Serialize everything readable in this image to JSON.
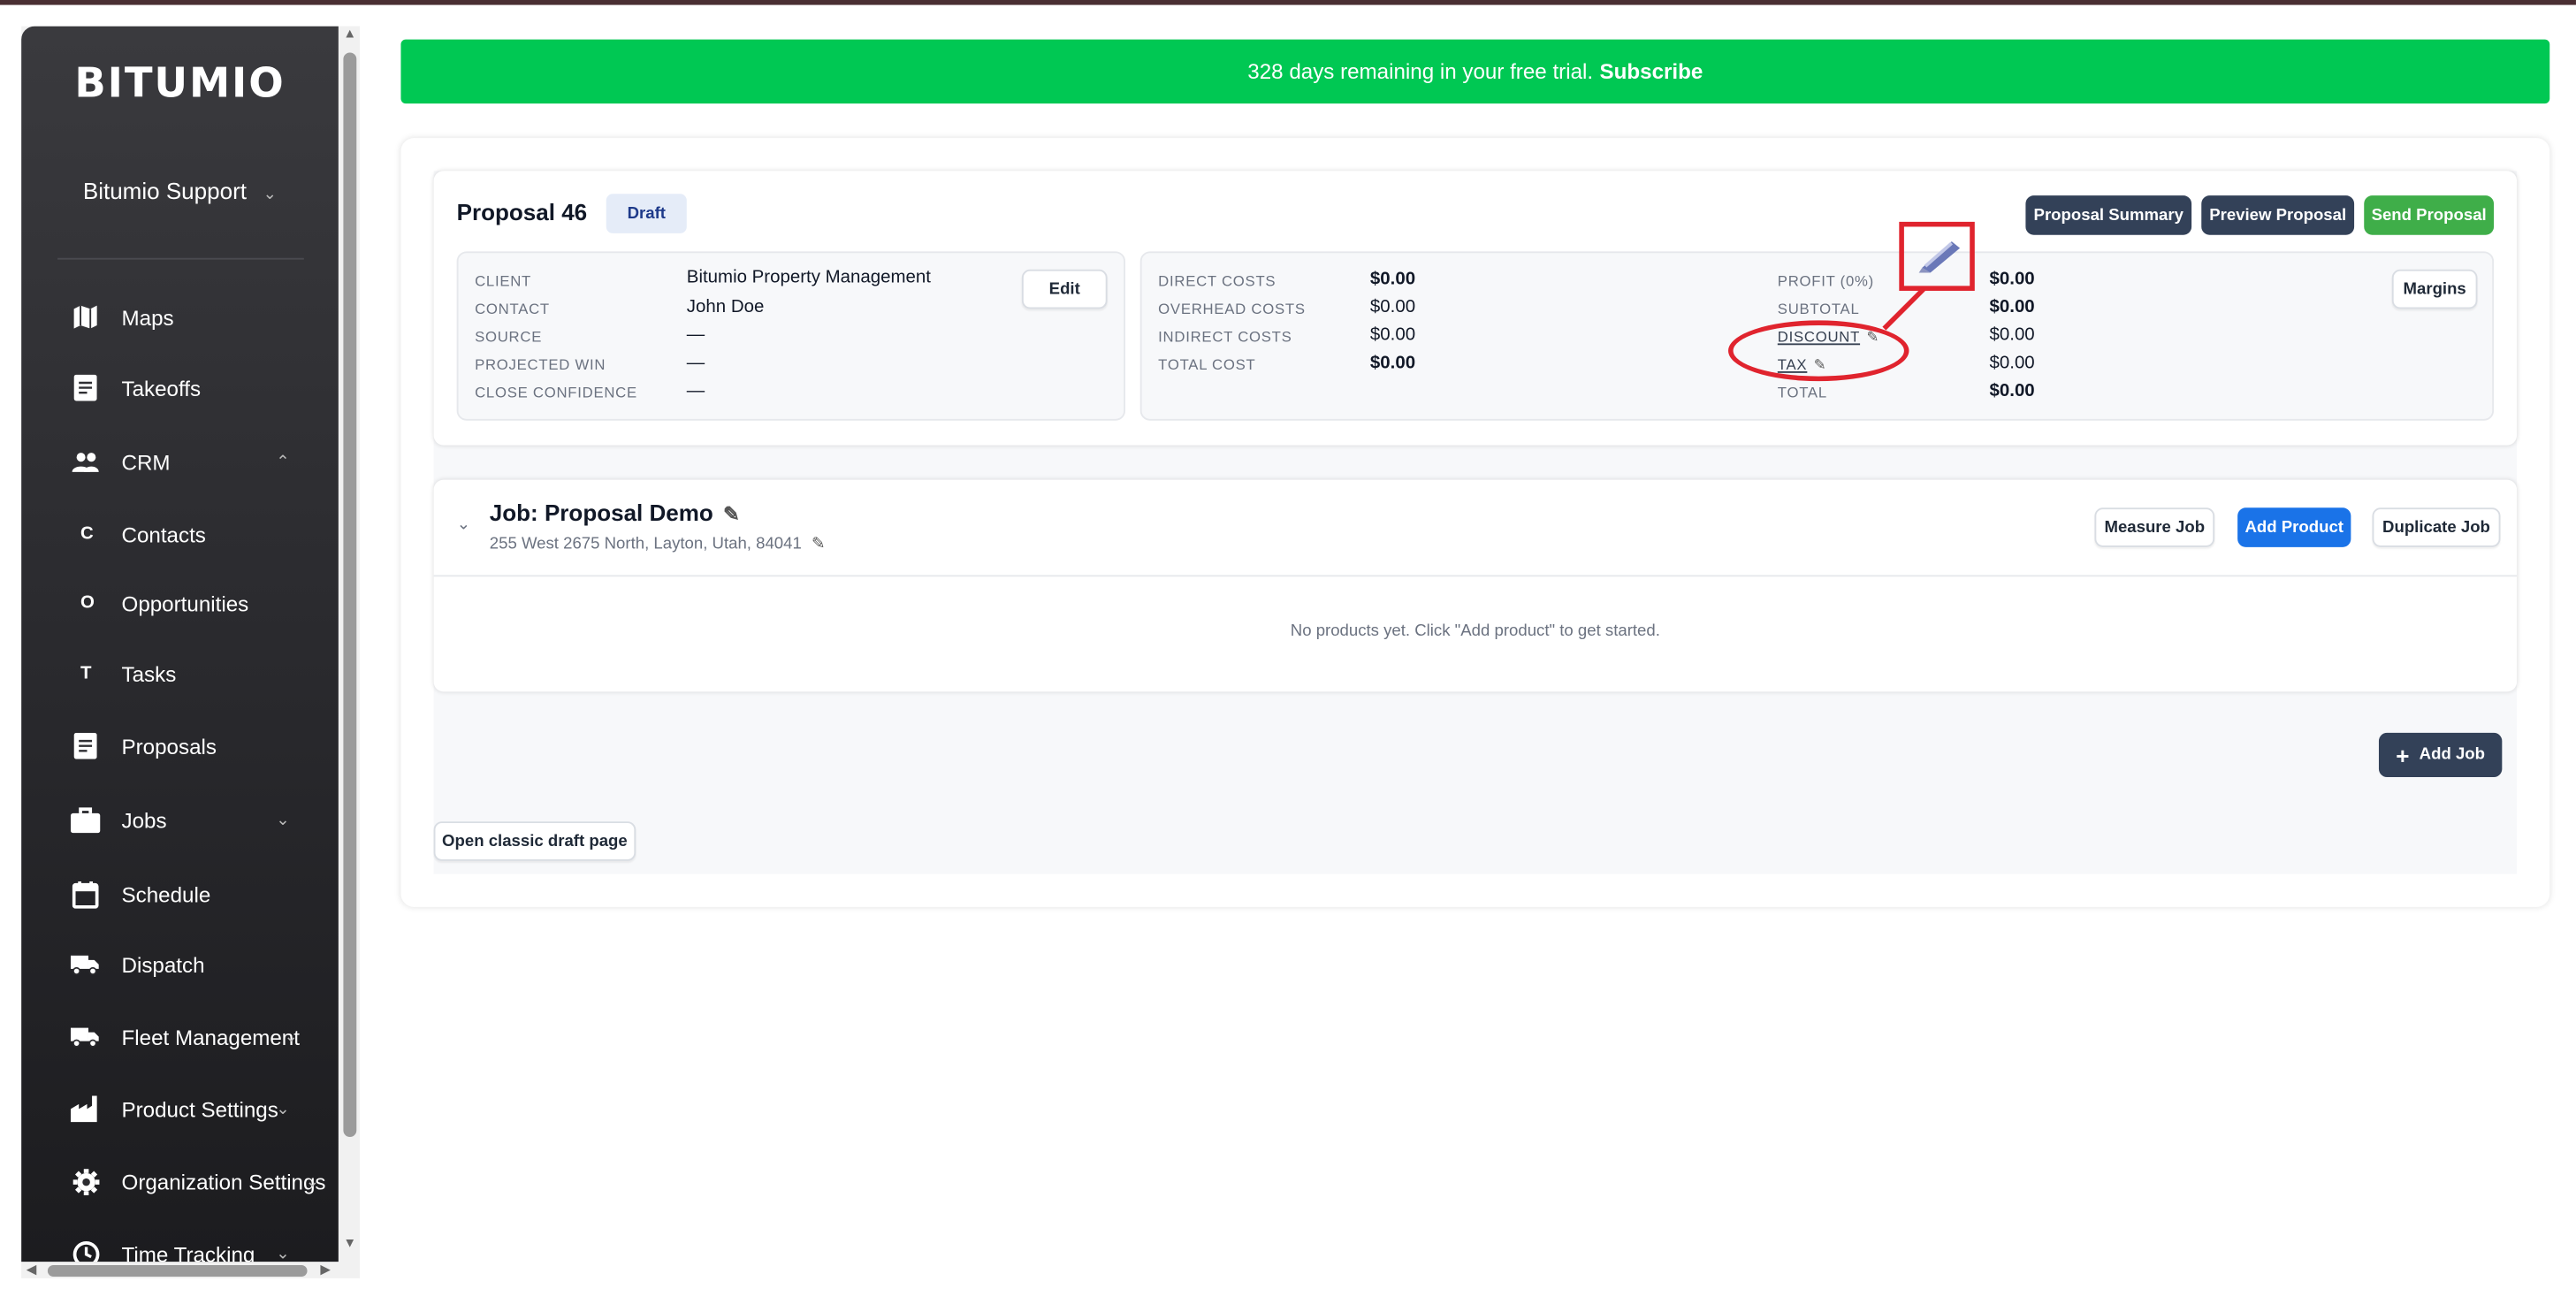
{
  "brand": {
    "logo": "BITUMIO"
  },
  "user": {
    "name": "Bitumio Support"
  },
  "sidebar": {
    "items": [
      {
        "label": "Maps",
        "icon": "map-icon"
      },
      {
        "label": "Takeoffs",
        "icon": "document-icon"
      },
      {
        "label": "CRM",
        "icon": "people-icon"
      },
      {
        "label": "Contacts",
        "letter": "C"
      },
      {
        "label": "Opportunities",
        "letter": "O"
      },
      {
        "label": "Tasks",
        "letter": "T"
      },
      {
        "label": "Proposals",
        "icon": "document-icon"
      },
      {
        "label": "Jobs",
        "icon": "briefcase-icon"
      },
      {
        "label": "Schedule",
        "icon": "calendar-icon"
      },
      {
        "label": "Dispatch",
        "icon": "truck-icon"
      },
      {
        "label": "Fleet Management",
        "icon": "truck-icon"
      },
      {
        "label": "Product Settings",
        "icon": "factory-icon"
      },
      {
        "label": "Organization Settings",
        "icon": "gear-icon"
      },
      {
        "label": "Time Tracking",
        "icon": "clock-icon"
      }
    ]
  },
  "banner": {
    "text": "328 days remaining in your free trial.",
    "link": "Subscribe"
  },
  "proposal": {
    "title": "Proposal 46",
    "status": "Draft",
    "buttons": {
      "summary": "Proposal Summary",
      "preview": "Preview Proposal",
      "send": "Send Proposal"
    },
    "client_info": {
      "labels": {
        "client": "CLIENT",
        "contact": "CONTACT",
        "source": "SOURCE",
        "projected_win": "PROJECTED WIN",
        "close_confidence": "CLOSE CONFIDENCE"
      },
      "values": {
        "client": "Bitumio Property Management",
        "contact": "John Doe",
        "source": "—",
        "projected_win": "—",
        "close_confidence": "—"
      },
      "edit": "Edit"
    },
    "costs": {
      "labels": {
        "direct": "DIRECT COSTS",
        "overhead": "OVERHEAD COSTS",
        "indirect": "INDIRECT COSTS",
        "total_cost": "TOTAL COST"
      },
      "values": {
        "direct": "$0.00",
        "overhead": "$0.00",
        "indirect": "$0.00",
        "total_cost": "$0.00"
      }
    },
    "totals": {
      "labels": {
        "profit": "PROFIT (0%)",
        "subtotal": "SUBTOTAL",
        "discount": "DISCOUNT",
        "tax": "TAX",
        "total": "TOTAL"
      },
      "values": {
        "profit": "$0.00",
        "subtotal": "$0.00",
        "discount": "$0.00",
        "tax": "$0.00",
        "total": "$0.00"
      },
      "margins": "Margins"
    }
  },
  "job": {
    "title": "Job: Proposal Demo",
    "address": "255 West 2675 North, Layton, Utah, 84041",
    "buttons": {
      "measure": "Measure Job",
      "add_product": "Add Product",
      "duplicate": "Duplicate Job"
    },
    "empty": "No products yet. Click \"Add product\" to get started."
  },
  "actions": {
    "add_job": "Add Job",
    "classic": "Open classic draft page"
  },
  "colors": {
    "banner": "#00c853",
    "primary_dark": "#334158",
    "send_green": "#3fae49",
    "blue": "#1a73e8",
    "annotation": "#e0242e"
  }
}
